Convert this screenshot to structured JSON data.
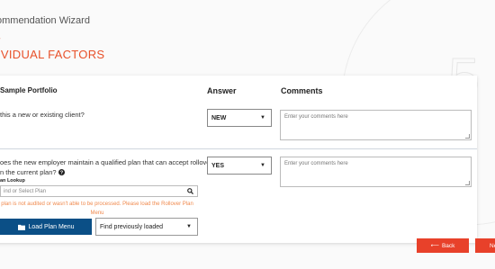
{
  "wizard": {
    "title": "ommendation Wizard",
    "dash": "-",
    "section_title": "IVIDUAL FACTORS"
  },
  "table": {
    "col_question": "Sample Portfolio",
    "col_answer": "Answer",
    "col_comments": "Comments"
  },
  "questions": [
    {
      "text": "this a new or existing client?",
      "answer": "NEW",
      "comment_placeholder": "Enter your comments here"
    },
    {
      "text_line1": "oes the new employer maintain a qualified plan that can accept rollovers",
      "text_line2": "n the current plan?",
      "help_icon": "question-circle-icon",
      "answer": "YES",
      "comment_placeholder": "Enter your comments here",
      "lookup_label": "an Lookup",
      "lookup_placeholder": "ind or Select Plan",
      "warning_line1": "plan is not audited or wasn't able to be processed. Please load the Rollover Plan",
      "warning_line2": "Menu",
      "load_button": "Load Plan Menu",
      "previous_select": "Find previously loaded"
    }
  ],
  "nav": {
    "back_label": "Back",
    "next_label": "Ne"
  },
  "colors": {
    "accent": "#e8512a",
    "primary": "#0b4f86",
    "warning": "#f0894d"
  }
}
